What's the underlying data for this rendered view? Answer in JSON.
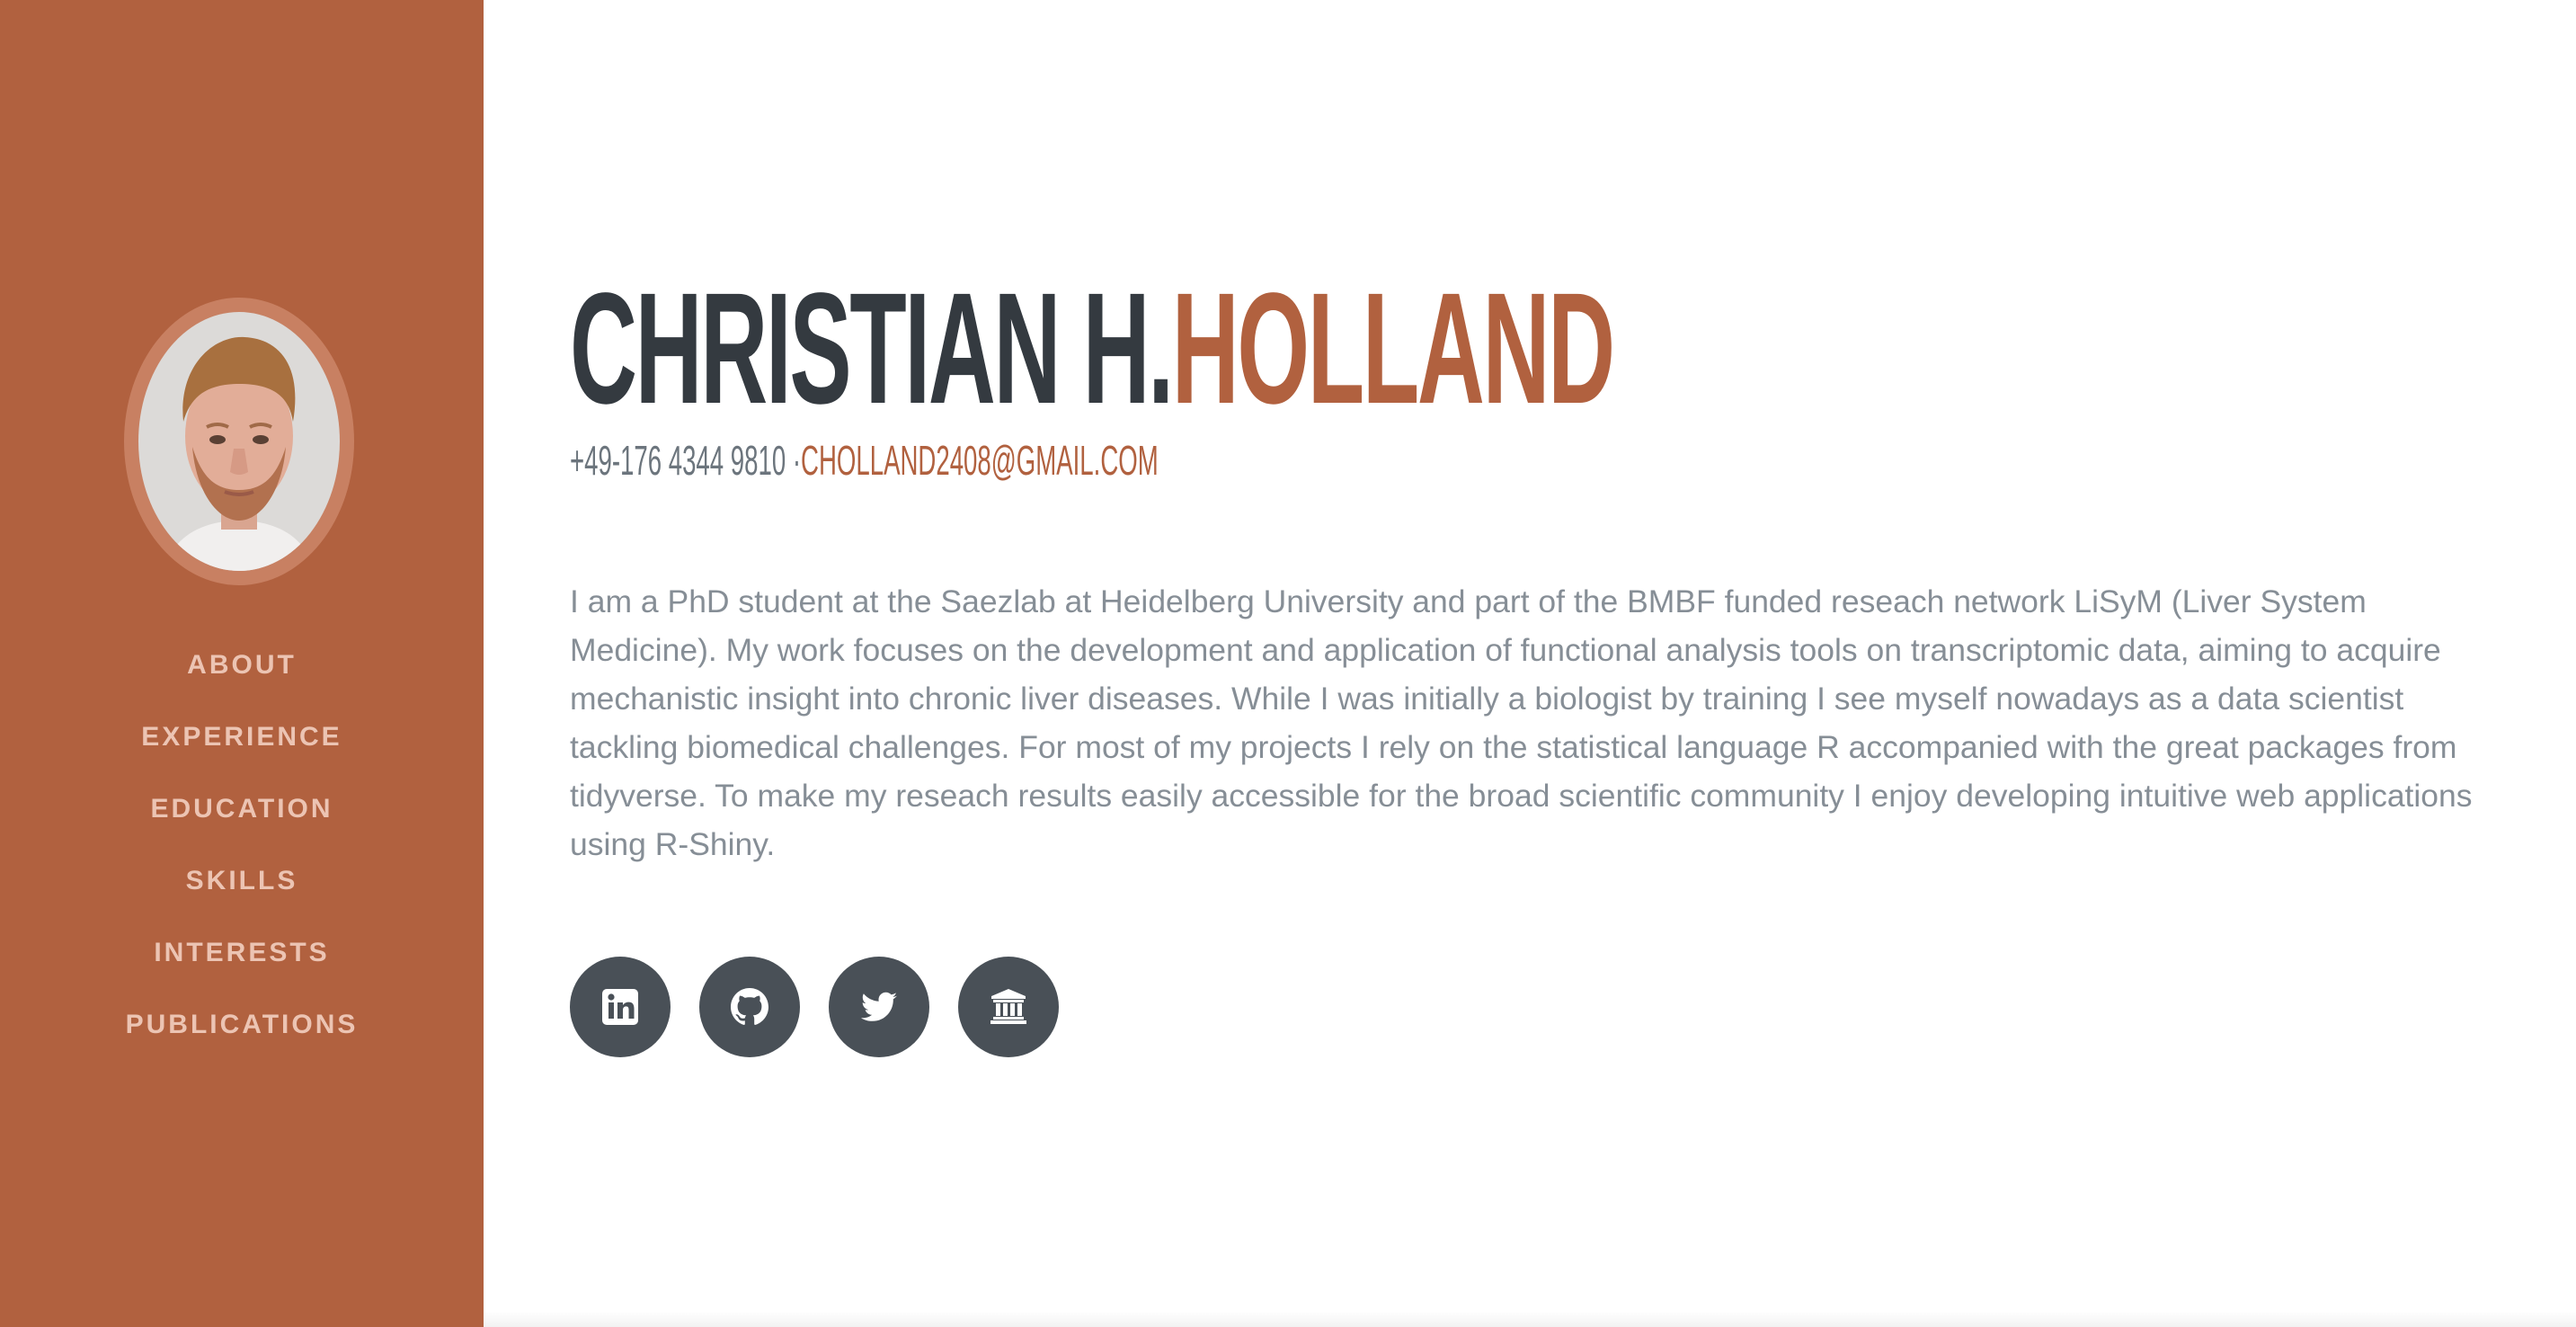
{
  "sidebar": {
    "nav": [
      {
        "label": "ABOUT"
      },
      {
        "label": "EXPERIENCE"
      },
      {
        "label": "EDUCATION"
      },
      {
        "label": "SKILLS"
      },
      {
        "label": "INTERESTS"
      },
      {
        "label": "PUBLICATIONS"
      }
    ]
  },
  "header": {
    "first_name": "CHRISTIAN H.",
    "last_name": "HOLLAND",
    "phone": "+49-176 4344 9810 ·",
    "email": "CHOLLAND2408@GMAIL.COM"
  },
  "about": {
    "text": "I am a PhD student at the Saezlab at Heidelberg University and part of the BMBF funded reseach network LiSyM (Liver System Medicine). My work focuses on the development and application of functional analysis tools on transcriptomic data, aiming to acquire mechanistic insight into chronic liver diseases. While I was initially a biologist by training I see myself nowadays as a data scientist tackling biomedical challenges. For most of my projects I rely on the statistical language R accompanied with the great packages from tidyverse. To make my reseach results easily accessible for the broad scientific community I enjoy developing intuitive web applications using R-Shiny."
  },
  "social": [
    {
      "icon": "linkedin-icon"
    },
    {
      "icon": "github-icon"
    },
    {
      "icon": "twitter-icon"
    },
    {
      "icon": "university-icon"
    }
  ],
  "colors": {
    "accent": "#b1613f",
    "sidebar_text": "#ecc4b3",
    "heading": "#343a40",
    "body_text": "#868e96",
    "social_bg": "#495057"
  }
}
